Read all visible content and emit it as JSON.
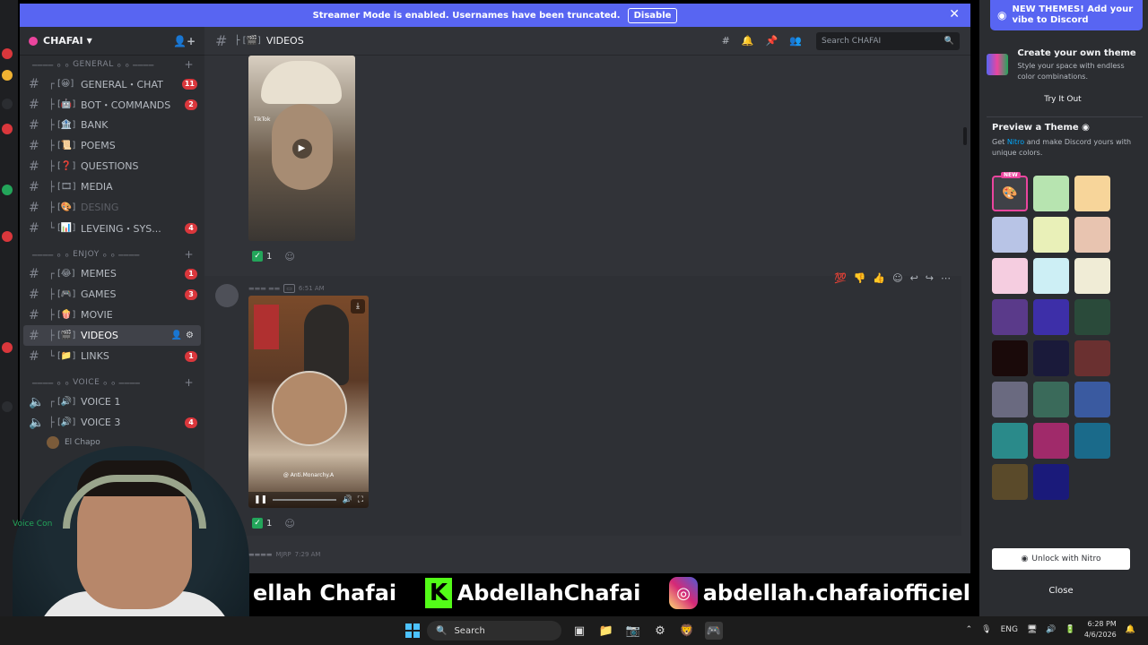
{
  "banner": {
    "text": "Streamer Mode is enabled. Usernames have been truncated.",
    "disable_label": "Disable",
    "close": "✕"
  },
  "guild": {
    "name": "CHAFAI"
  },
  "categories": {
    "general": "GENERAL",
    "enjoy": "ENJOY",
    "voice": "VOICE"
  },
  "channels": {
    "general_chat": {
      "name": "GENERAL・CHAT",
      "badge": "11"
    },
    "bot_commands": {
      "name": "BOT・COMMANDS",
      "badge": "2"
    },
    "bank": {
      "name": "BANK"
    },
    "poems": {
      "name": "POEMS"
    },
    "questions": {
      "name": "QUESTIONS"
    },
    "media": {
      "name": "MEDIA"
    },
    "desing": {
      "name": "DESING"
    },
    "leveing": {
      "name": "LEVEING・SYS...",
      "badge": "4"
    },
    "memes": {
      "name": "MEMES",
      "badge": "1"
    },
    "games": {
      "name": "GAMES",
      "badge": "3"
    },
    "movie": {
      "name": "MOVIE"
    },
    "videos": {
      "name": "VIDEOS"
    },
    "links": {
      "name": "LINKS",
      "badge": "1"
    },
    "voice1": {
      "name": "VOICE 1"
    },
    "voice3": {
      "name": "VOICE 3",
      "badge": "4"
    }
  },
  "voice_user": "El Chapo",
  "voice_connected": "Voice Con",
  "header": {
    "channel": "VIDEOS",
    "search_placeholder": "Search CHAFAI"
  },
  "messages": {
    "reaction1_count": "1",
    "reaction2_count": "1",
    "msg2_time": "6:51 AM",
    "msg3_tag": "MJRP",
    "msg3_time": "7:29 AM",
    "video2_caption": "@ Anti.Monarchy.A",
    "video1_watermark": "TikTok"
  },
  "right_panel": {
    "new_themes": "NEW THEMES! Add your vibe to Discord",
    "create_title": "Create your own theme",
    "create_desc": "Style your space with endless color combinations.",
    "try_label": "Try It Out",
    "preview_title": "Preview a Theme",
    "preview_desc_pre": "Get ",
    "preview_desc_link": "Nitro",
    "preview_desc_post": " and make Discord yours with unique colors.",
    "new_tag": "NEW",
    "unlock_label": "Unlock with Nitro",
    "close_label": "Close",
    "swatch_colors": [
      "#b7e4b0",
      "#f7d59a",
      "#b8c4e6",
      "#e9f0b8",
      "#e8c4b0",
      "#f5cde0",
      "#cdeff5",
      "#f0ecd6",
      "#5a3a8a",
      "#3d2fa8",
      "#2a4a3a",
      "#1a0a0a",
      "#1a1a3a",
      "#6a3030",
      "#6a6a80",
      "#3a6a5a",
      "#3a5aa0",
      "#2a8a8a",
      "#a02a6a",
      "#1a6a8a",
      "#5a4a2a",
      "#1a1a7a"
    ]
  },
  "overlay": {
    "name_fragment": "ellah Chafai",
    "kick_handle": "AbdellahChafai",
    "instagram_handle": "abdellah.chafaiofficiel"
  },
  "taskbar": {
    "search": "Search",
    "lang": "ENG",
    "time": "6:28 PM",
    "date": "4/6/2026"
  }
}
